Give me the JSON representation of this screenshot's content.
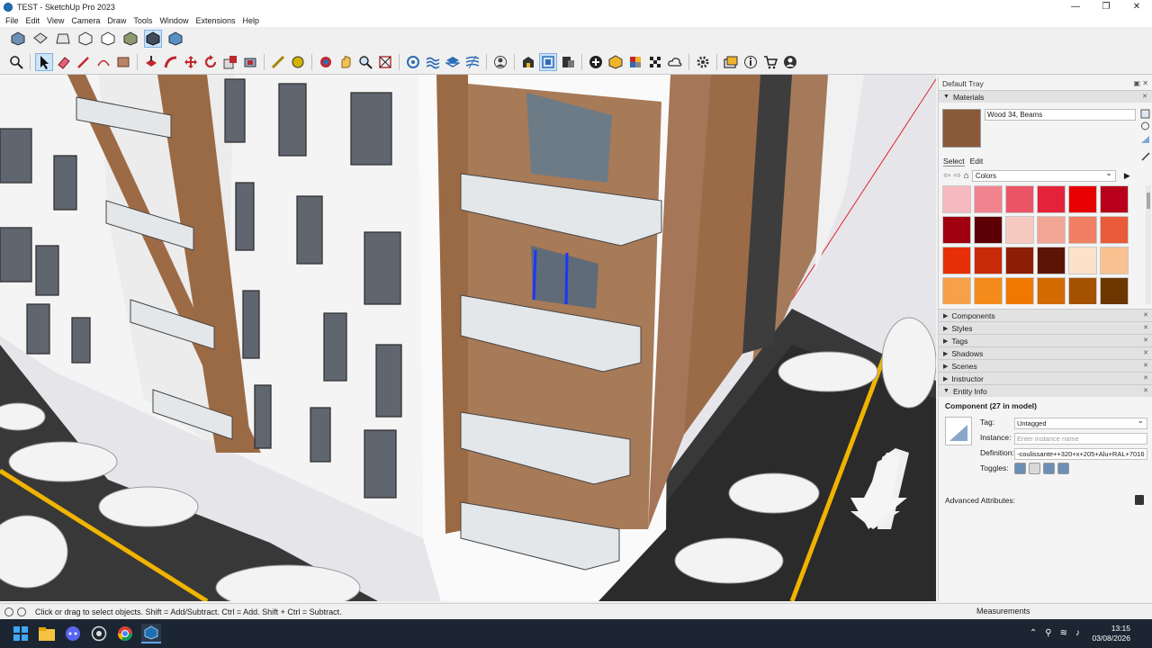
{
  "window": {
    "title": "TEST - SketchUp Pro 2023",
    "minimize": "—",
    "maximize": "❐",
    "close": "✕"
  },
  "menu": [
    "File",
    "Edit",
    "View",
    "Camera",
    "Draw",
    "Tools",
    "Window",
    "Extensions",
    "Help"
  ],
  "toolbar1": [
    "iso-view-icon",
    "top-view-icon",
    "front-view-icon",
    "wireframe-icon",
    "hidden-line-icon",
    "shaded-icon",
    "shaded-textures-icon"
  ],
  "toolbar2": [
    "search-icon",
    "select-icon",
    "eraser-icon",
    "pencil-icon",
    "shape-icon",
    "paint-bucket-icon",
    "push-pull-icon",
    "follow-me-icon",
    "move-icon",
    "rotate-icon",
    "scale-icon",
    "offset-icon",
    "tape-measure-icon",
    "paint-icon",
    "orbit-icon",
    "pan-icon",
    "zoom-icon",
    "zoom-extents-icon",
    "sandbox-icon",
    "section-icon",
    "layers-icon",
    "solid-tools-icon",
    "user-icon",
    "warehouse-icon",
    "extension-icon",
    "layout-icon",
    "add-icon",
    "model-info-icon",
    "materials-icon",
    "checker-icon",
    "cloud-icon",
    "settings-icon",
    "folder-icon",
    "info-icon",
    "cart-icon",
    "account-icon"
  ],
  "tray": {
    "title": "Default Tray",
    "materials": {
      "header": "Materials",
      "current_material": "Wood 34, Beams",
      "current_color": "#8a5a38",
      "tab_select": "Select",
      "tab_edit": "Edit",
      "library": "Colors",
      "swatches": [
        "#f7b9c0",
        "#f1838f",
        "#ec5565",
        "#e4233a",
        "#e60000",
        "#b8001a",
        "#a00010",
        "#5c0006",
        "#f6c9c0",
        "#f2a594",
        "#f07f64",
        "#ea5b3a",
        "#e62f07",
        "#c72a06",
        "#8b1e05",
        "#5a1504",
        "#fde2c9",
        "#f8c291",
        "#f6a04a",
        "#f58b1b",
        "#f07800",
        "#d26a00",
        "#a45200",
        "#6b3600"
      ]
    },
    "sections": [
      "Components",
      "Styles",
      "Tags",
      "Shadows",
      "Scenes",
      "Instructor"
    ],
    "entity_info": {
      "header": "Entity Info",
      "heading": "Component (27 in model)",
      "tag_label": "Tag:",
      "tag_value": "Untagged",
      "instance_label": "Instance:",
      "instance_placeholder": "Enter instance name",
      "definition_label": "Definition:",
      "definition_value": "-coulissante++320+x+205+Alu+RAL+7016",
      "toggles_label": "Toggles:",
      "advanced": "Advanced Attributes:"
    }
  },
  "status": {
    "hint": "Click or drag to select objects. Shift = Add/Subtract. Ctrl = Add. Shift + Ctrl = Subtract.",
    "measurements_label": "Measurements"
  },
  "taskbar": {
    "time": "13:15",
    "date": "03/08/2026"
  }
}
